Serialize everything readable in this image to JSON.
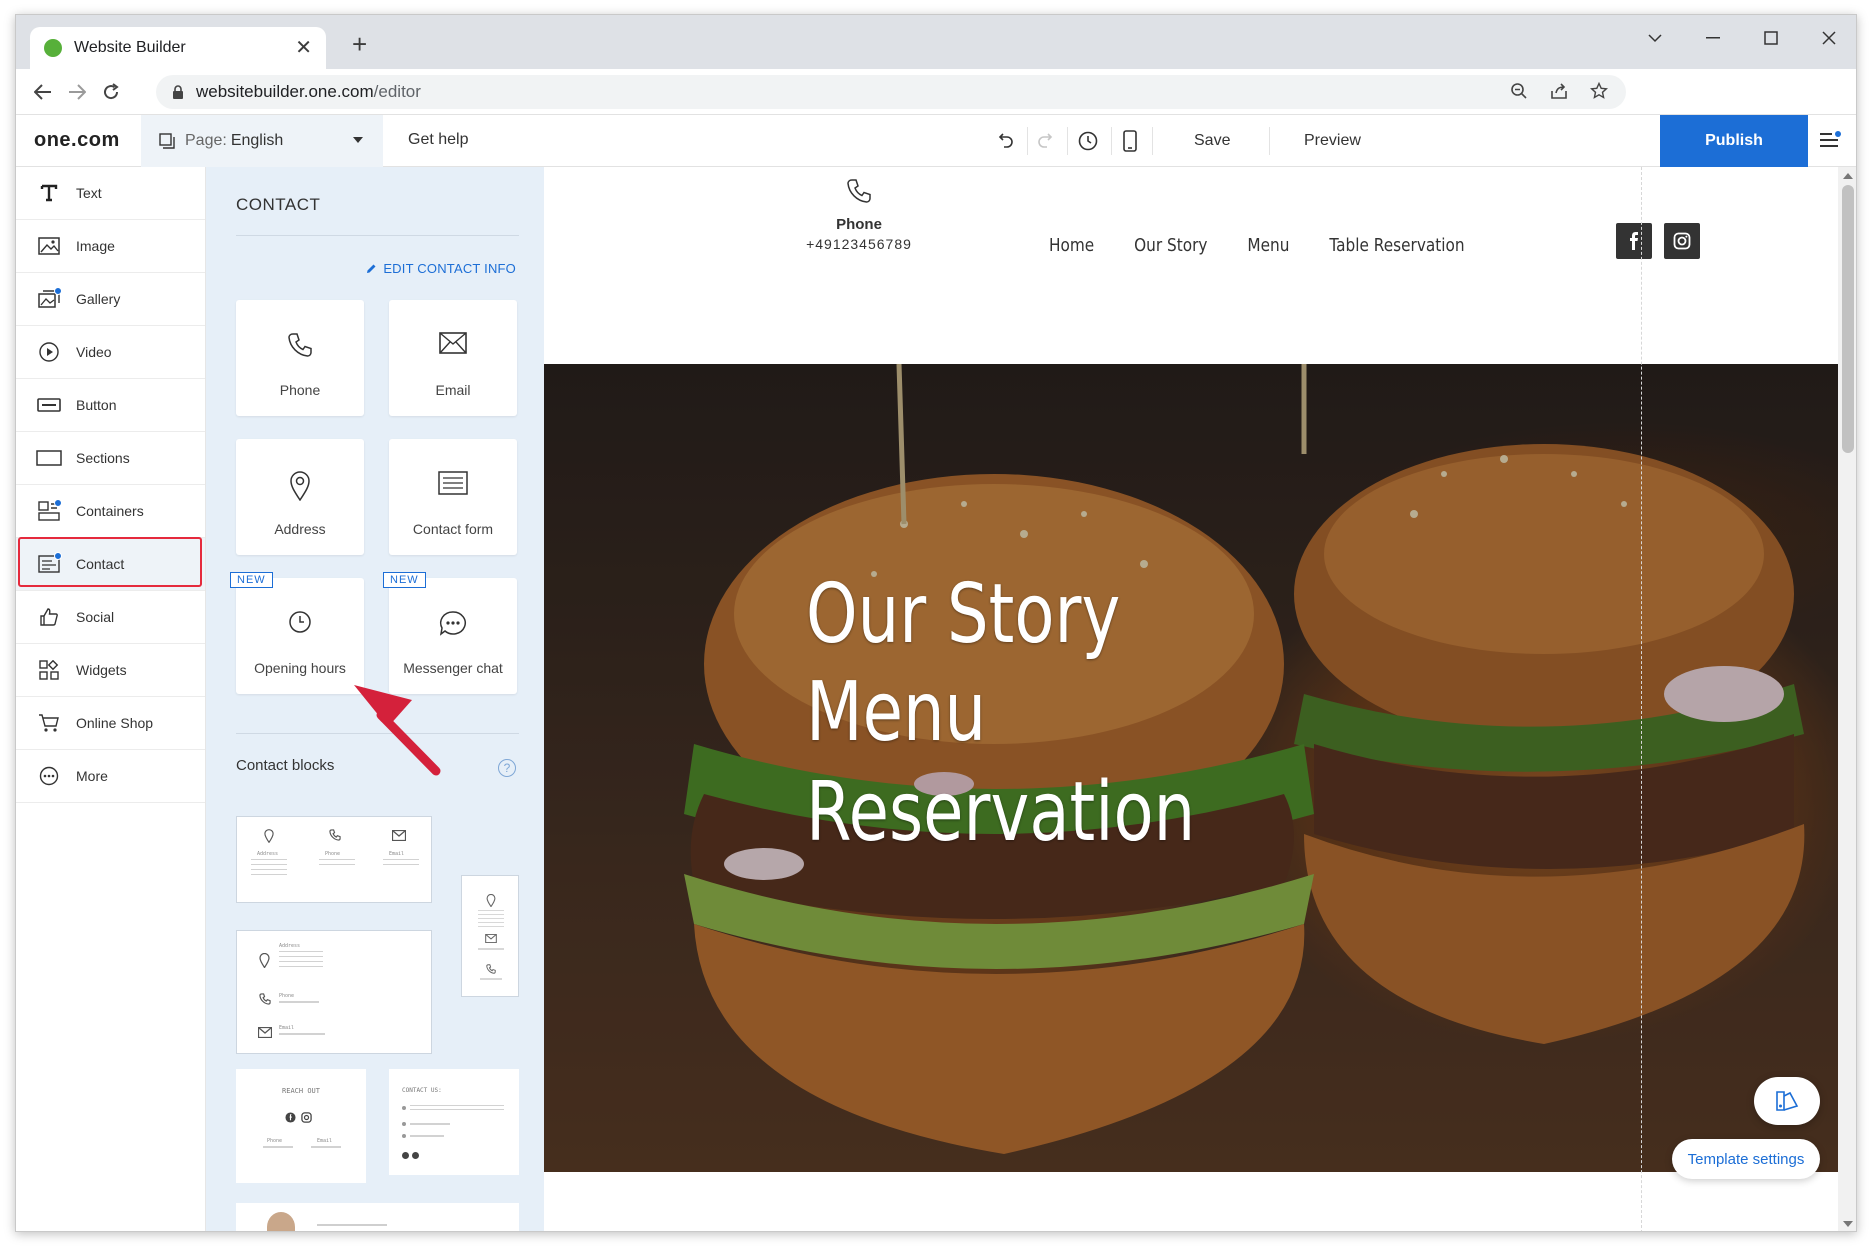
{
  "browser": {
    "tab_title": "Website Builder",
    "url_domain": "websitebuilder.one.com",
    "url_path": "/editor"
  },
  "toolbar": {
    "logo": "one.com",
    "page_label": "Page:",
    "page_value": "English",
    "get_help": "Get help",
    "save": "Save",
    "preview": "Preview",
    "publish": "Publish"
  },
  "sidebar": {
    "items": [
      {
        "label": "Text",
        "icon": "text-icon"
      },
      {
        "label": "Image",
        "icon": "image-icon"
      },
      {
        "label": "Gallery",
        "icon": "gallery-icon"
      },
      {
        "label": "Video",
        "icon": "video-icon"
      },
      {
        "label": "Button",
        "icon": "button-icon"
      },
      {
        "label": "Sections",
        "icon": "sections-icon"
      },
      {
        "label": "Containers",
        "icon": "containers-icon"
      },
      {
        "label": "Contact",
        "icon": "contact-icon"
      },
      {
        "label": "Social",
        "icon": "thumbs-up-icon"
      },
      {
        "label": "Widgets",
        "icon": "widgets-icon"
      },
      {
        "label": "Online Shop",
        "icon": "cart-icon"
      },
      {
        "label": "More",
        "icon": "more-icon"
      }
    ],
    "active": "Contact"
  },
  "panel": {
    "title": "CONTACT",
    "edit_link": "EDIT CONTACT INFO",
    "cards": [
      {
        "label": "Phone",
        "icon": "phone-icon",
        "badge": ""
      },
      {
        "label": "Email",
        "icon": "email-icon",
        "badge": ""
      },
      {
        "label": "Address",
        "icon": "location-pin-icon",
        "badge": ""
      },
      {
        "label": "Contact form",
        "icon": "form-icon",
        "badge": ""
      },
      {
        "label": "Opening hours",
        "icon": "clock-icon",
        "badge": "NEW"
      },
      {
        "label": "Messenger chat",
        "icon": "chat-icon",
        "badge": "NEW"
      }
    ],
    "blocks_title": "Contact blocks",
    "blocks_help": "?",
    "block_texts": {
      "address": "Address",
      "phone": "Phone",
      "email": "Email",
      "reach_out": "REACH OUT",
      "contact_us": "CONTACT US:"
    }
  },
  "site": {
    "phone_label": "Phone",
    "phone_number": "+49123456789",
    "nav": [
      "Home",
      "Our Story",
      "Menu",
      "Table Reservation"
    ],
    "hero_lines": [
      "Our Story",
      "Menu",
      "Reservation"
    ],
    "template_settings": "Template settings"
  },
  "colors": {
    "accent": "#1c6ed6",
    "panel_bg": "#e6eff8",
    "highlight": "#e52a3d"
  }
}
